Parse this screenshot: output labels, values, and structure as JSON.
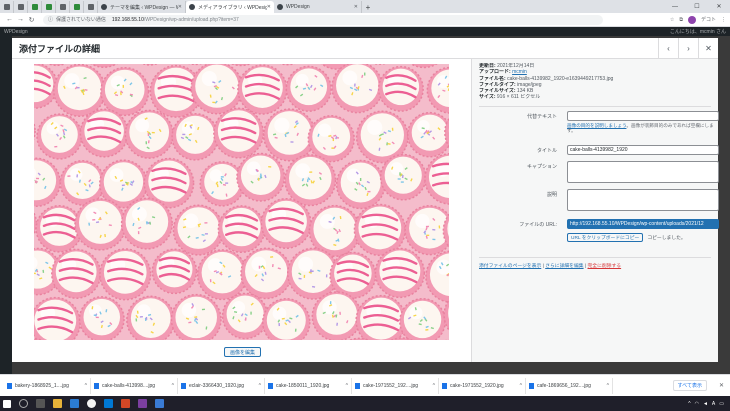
{
  "browser": {
    "tabs": [
      {
        "label": "",
        "kind": "mini"
      },
      {
        "label": "",
        "kind": "mini"
      },
      {
        "label": "",
        "kind": "mini-green"
      },
      {
        "label": "",
        "kind": "mini-green"
      },
      {
        "label": "",
        "kind": "mini"
      },
      {
        "label": "",
        "kind": "mini-green"
      },
      {
        "label": "",
        "kind": "mini"
      },
      {
        "label": "テーマを編集 ‹ WPDesign — Word",
        "kind": "wide"
      },
      {
        "label": "メディアライブラリ ‹ WPDesign — W",
        "kind": "wide-active"
      },
      {
        "label": "WPDesign",
        "kind": "wide"
      }
    ],
    "new_tab": "+",
    "address": {
      "insecure_label": "保護されていない通信",
      "host": "192.168.55.10",
      "path": "/WPDesign/wp-admin/upload.php?item=37"
    },
    "profile_label": "デコト"
  },
  "wp": {
    "admin_bar_left": "WPDesign",
    "admin_bar_right": "こんにちは、mcmin さん"
  },
  "modal": {
    "title": "添付ファイルの詳細",
    "edit_image_button": "画像を編集",
    "details": {
      "uploaded_on_label": "更新日:",
      "uploaded_on": "2021年12月14日",
      "uploaded_by_label": "アップロード:",
      "uploaded_by": "mcmin",
      "file_name_label": "ファイル名:",
      "file_name": "cake-balls-4139982_1920-e1639449217753.jpg",
      "file_type_label": "ファイルタイプ:",
      "file_type": "image/jpeg",
      "file_size_label": "ファイルサイズ:",
      "file_size": "134 KB",
      "dimensions_label": "サイズ:",
      "dimensions": "916 × 611 ピクセル"
    },
    "fields": {
      "alt_label": "代替テキスト",
      "alt_value": "",
      "alt_help_link": "画像の目的を説明しましょう",
      "alt_help_text": "。画像が装飾目的のみであれば空欄にします。",
      "title_label": "タイトル",
      "title_value": "cake-balls-4139982_1920",
      "caption_label": "キャプション",
      "caption_value": "",
      "description_label": "説明",
      "description_value": "",
      "url_label": "ファイルの URL:",
      "url_value": "http://192.168.55.10/WPDesign/wp-content/uploads/2021/12",
      "copy_button": "URL をクリップボードにコピー",
      "copied_text": "コピーしました。"
    },
    "actions": {
      "view": "添付ファイルのページを表示",
      "edit_more": "さらに詳細を編集",
      "delete": "完全に削除する"
    }
  },
  "downloads": {
    "items": [
      "bakery-1868925_1....jpg",
      "cake-balls-413998....jpg",
      "eclair-3366430_1920.jpg",
      "cake-1850011_1920.jpg",
      "cake-1971552_192....jpg",
      "cake-1971552_1920.jpg",
      "cafe-1869656_192....jpg"
    ],
    "show_all": "すべて表示"
  },
  "taskbar": {
    "tray_lang": "A",
    "tray_time": ""
  },
  "colors": {
    "wp_blue": "#2271b1",
    "wp_dark": "#1d2327",
    "delete_red": "#d63638",
    "photo_pink": "#f6c9d3"
  }
}
